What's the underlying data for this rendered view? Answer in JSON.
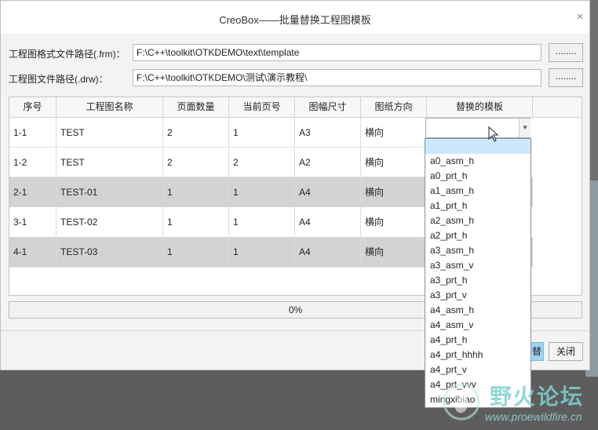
{
  "window": {
    "title": "CreoBox——批量替换工程图模板",
    "close_glyph": "×"
  },
  "paths": {
    "frm_label": "工程图格式文件路径(.frm)：",
    "frm_value": "F:\\C++\\toolkit\\OTKDEMO\\text\\template",
    "drw_label": "工程图文件路径(.drw)：",
    "drw_value": "F:\\C++\\toolkit\\OTKDEMO\\测试\\演示教程\\",
    "browse_label": "........"
  },
  "table": {
    "columns": [
      "序号",
      "工程图名称",
      "页面数量",
      "当前页号",
      "图幅尺寸",
      "图纸方向",
      "替换的模板"
    ],
    "rows": [
      [
        "1-1",
        "TEST",
        "2",
        "1",
        "A3",
        "横向"
      ],
      [
        "1-2",
        "TEST",
        "2",
        "2",
        "A2",
        "横向"
      ],
      [
        "2-1",
        "TEST-01",
        "1",
        "1",
        "A4",
        "横向"
      ],
      [
        "3-1",
        "TEST-02",
        "1",
        "1",
        "A4",
        "横向"
      ],
      [
        "4-1",
        "TEST-03",
        "1",
        "1",
        "A4",
        "横向"
      ]
    ]
  },
  "combo": {
    "value": "",
    "arrow_glyph": "▼"
  },
  "dropdown": {
    "options": [
      "",
      "a0_asm_h",
      "a0_prt_h",
      "a1_asm_h",
      "a1_prt_h",
      "a2_asm_h",
      "a2_prt_h",
      "a3_asm_h",
      "a3_asm_v",
      "a3_prt_h",
      "a3_prt_v",
      "a4_asm_h",
      "a4_asm_v",
      "a4_prt_h",
      "a4_prt_hhhh",
      "a4_prt_v",
      "a4_prt_vvv",
      "mingxibiao"
    ]
  },
  "progress": {
    "text": "0%",
    "value": 0
  },
  "buttons": {
    "replace_label": "替换",
    "close_label": "关闭"
  },
  "watermark": {
    "text": "野火论坛",
    "url": "www.proewildfire.cn"
  },
  "colors": {
    "selected_option": "#cce8ff",
    "shaded_row": "#d3d3d3",
    "primary_button": "#9fd3f5"
  }
}
